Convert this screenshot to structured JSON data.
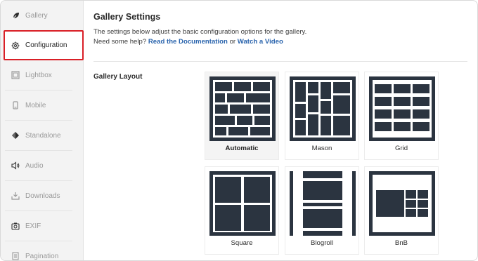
{
  "sidebar": {
    "items": [
      {
        "label": "Gallery",
        "icon": "leaf-icon"
      },
      {
        "label": "Configuration",
        "icon": "gear-icon",
        "active": true
      },
      {
        "label": "Lightbox",
        "icon": "lightbox-icon"
      },
      {
        "label": "Mobile",
        "icon": "mobile-icon"
      },
      {
        "label": "Standalone",
        "icon": "standalone-icon"
      },
      {
        "label": "Audio",
        "icon": "speaker-icon"
      },
      {
        "label": "Downloads",
        "icon": "download-icon"
      },
      {
        "label": "EXIF",
        "icon": "camera-icon"
      },
      {
        "label": "Pagination",
        "icon": "pagination-icon"
      }
    ]
  },
  "main": {
    "title": "Gallery Settings",
    "description": "The settings below adjust the basic configuration options for the gallery.",
    "help_prefix": "Need some help?",
    "doc_link": "Read the Documentation",
    "or_text": "or",
    "video_link": "Watch a Video",
    "layout_label": "Gallery Layout",
    "layouts": [
      {
        "label": "Automatic",
        "selected": true
      },
      {
        "label": "Mason"
      },
      {
        "label": "Grid"
      },
      {
        "label": "Square"
      },
      {
        "label": "Blogroll"
      },
      {
        "label": "BnB"
      }
    ]
  },
  "colors": {
    "accent_border": "#d91f26",
    "link": "#2a64ad",
    "icon_dark": "#2b3440"
  }
}
